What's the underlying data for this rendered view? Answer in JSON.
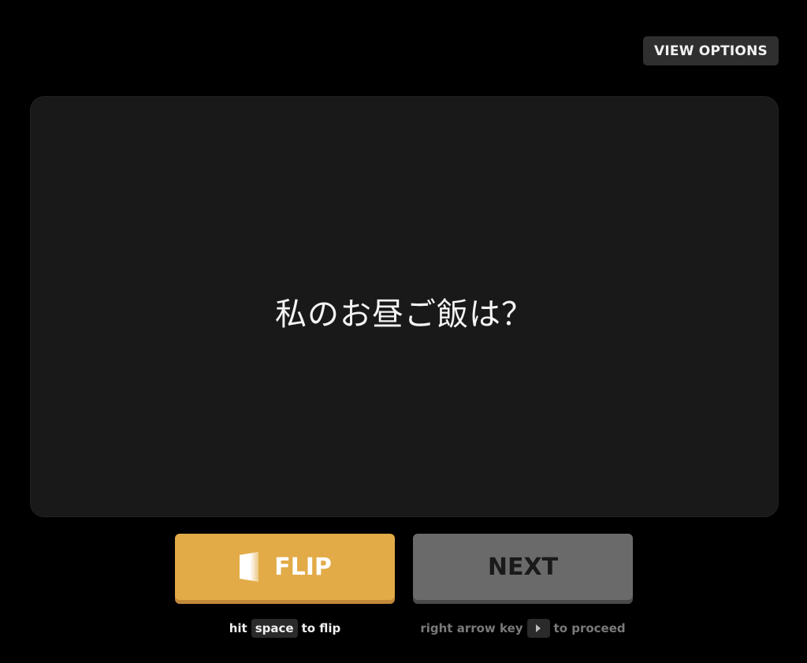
{
  "header": {
    "view_options_label": "VIEW OPTIONS"
  },
  "card": {
    "prompt": "私のお昼ご飯は？"
  },
  "controls": {
    "flip_label": "FLIP",
    "next_label": "NEXT",
    "flip_hint": {
      "prefix": "hit",
      "key": "space",
      "suffix": "to flip"
    },
    "next_hint": {
      "prefix": "right arrow key",
      "key_icon": "right-arrow-icon",
      "suffix": "to proceed"
    }
  },
  "colors": {
    "background": "#000000",
    "card": "#191919",
    "flip_button": "#e2ab47",
    "next_button": "#6a6a6a"
  }
}
